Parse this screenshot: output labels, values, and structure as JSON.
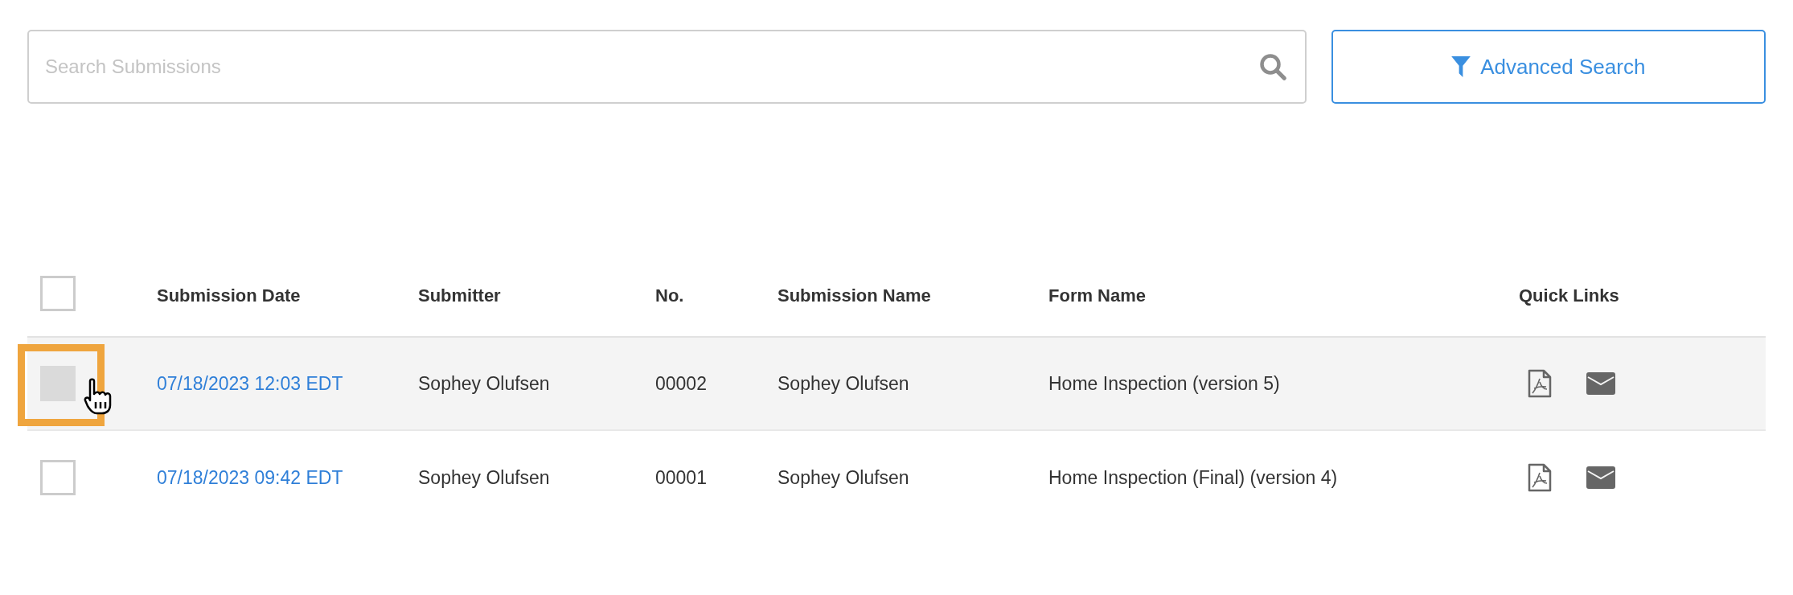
{
  "search": {
    "placeholder": "Search Submissions"
  },
  "advanced_search": {
    "label": "Advanced Search"
  },
  "table": {
    "select_all": {
      "checked": false
    },
    "columns": [
      "Submission Date",
      "Submitter",
      "No.",
      "Submission Name",
      "Form Name",
      "Quick Links"
    ],
    "rows": [
      {
        "highlighted": true,
        "checked": false,
        "date": "07/18/2023 12:03 EDT",
        "submitter": "Sophey Olufsen",
        "number": "00002",
        "submission_name": "Sophey Olufsen",
        "form_name": "Home Inspection (version 5)"
      },
      {
        "highlighted": false,
        "checked": false,
        "date": "07/18/2023 09:42 EDT",
        "submitter": "Sophey Olufsen",
        "number": "00001",
        "submission_name": "Sophey Olufsen",
        "form_name": "Home Inspection (Final) (version 4)"
      }
    ]
  }
}
